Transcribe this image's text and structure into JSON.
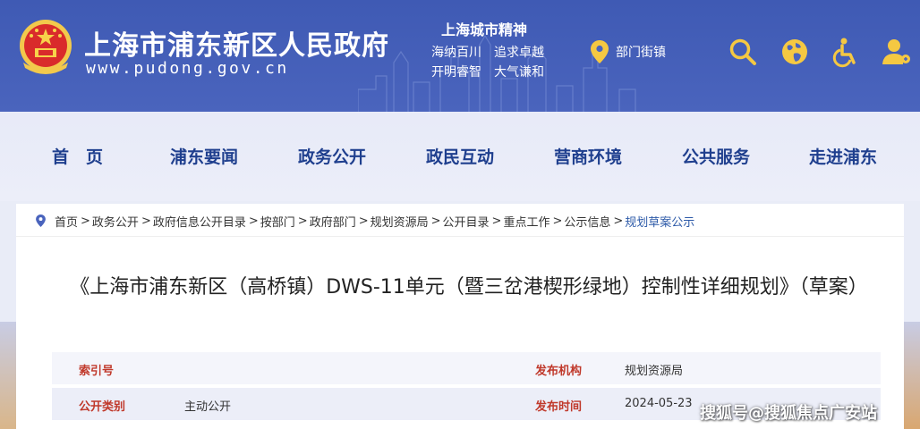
{
  "header": {
    "site_title": "上海市浦东新区人民政府",
    "site_url": "www.pudong.gov.cn",
    "spirit_title": "上海城市精神",
    "spirit_line1": "海纳百川　追求卓越",
    "spirit_line2": "开明睿智　大气谦和",
    "dept_label": "部门街镇",
    "icons": [
      "search-icon",
      "globe-icon",
      "accessibility-icon",
      "user-icon"
    ]
  },
  "nav": {
    "items": [
      "首　页",
      "浦东要闻",
      "政务公开",
      "政民互动",
      "营商环境",
      "公共服务",
      "走进浦东"
    ]
  },
  "breadcrumb": {
    "items": [
      "首页",
      "政务公开",
      "政府信息公开目录",
      "按部门",
      "政府部门",
      "规划资源局",
      "公开目录",
      "重点工作",
      "公示信息",
      "规划草案公示"
    ],
    "separator": ">"
  },
  "document": {
    "title": "《上海市浦东新区（高桥镇）DWS-11单元（暨三岔港楔形绿地）控制性详细规划》（草案）"
  },
  "meta": {
    "rows": [
      {
        "label1": "索引号",
        "value1": "",
        "label2": "发布机构",
        "value2": "规划资源局"
      },
      {
        "label1": "公开类别",
        "value1": "主动公开",
        "label2": "发布时间",
        "value2": "2024-05-23"
      }
    ]
  },
  "watermark": "搜狐号@搜狐焦点广安站",
  "colors": {
    "header_bg": "#4a64bd",
    "nav_text": "#1f3f8e",
    "meta_label": "#c0392b",
    "breadcrumb_current": "#2d5aa8"
  }
}
